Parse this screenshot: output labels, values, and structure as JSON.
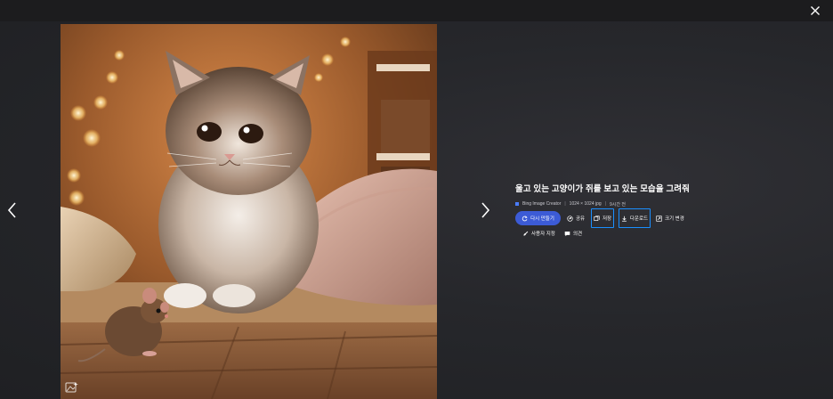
{
  "window": {
    "close_icon": "close-icon",
    "prev_icon": "chevron-left-icon",
    "next_icon": "chevron-right-icon"
  },
  "image": {
    "subject": "fluffy kitten looking at a small mouse",
    "corner_icon": "image-creator-icon"
  },
  "details": {
    "title": "울고 있는 고양이가 쥐를 보고 있는 모습을 그려줘",
    "meta": {
      "source": "Bing Image Creator",
      "separator": "|",
      "dimensions": "1024 × 1024 jpg",
      "time": "9시간 전"
    },
    "actions": {
      "regenerate": "다시 만들기",
      "share": "공유",
      "save": "저장",
      "download": "다운로드",
      "resize": "크기 변경",
      "customize": "사용자 지정",
      "feedback": "의견"
    }
  },
  "colors": {
    "primary_button": "#3c5bd6",
    "highlight_outline": "#1a8fff",
    "background": "#26272b"
  }
}
